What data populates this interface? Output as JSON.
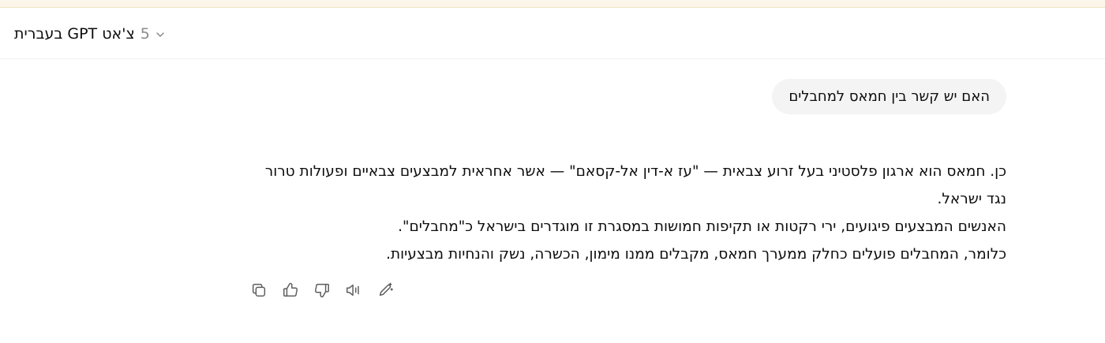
{
  "header": {
    "model_name": "צ'אט GPT בעברית",
    "model_version": "5",
    "chevron_icon": "chevron-down-icon"
  },
  "conversation": {
    "user_message": "האם יש קשר בין חמאס למחבלים",
    "assistant_lines": [
      "כן. חמאס הוא ארגון פלסטיני בעל זרוע צבאית — \"עז א-דין אל-קסאם\" — אשר אחראית למבצעים צבאיים ופעולות טרור נגד ישראל.",
      "האנשים המבצעים פיגועים, ירי רקטות או תקיפות חמושות במסגרת זו מוגדרים בישראל כ\"מחבלים\".",
      "כלומר, המחבלים פועלים כחלק ממערך חמאס, מקבלים ממנו מימון, הכשרה, נשק והנחיות מבצעיות."
    ]
  },
  "actions": {
    "icons": [
      "copy-icon",
      "thumbs-up-icon",
      "thumbs-down-icon",
      "read-aloud-icon",
      "edit-icon"
    ]
  },
  "colors": {
    "top_strip": "#fbf6e9",
    "bubble_bg": "#f4f4f4",
    "text": "#0d0d0d",
    "muted": "#8a8a8a",
    "icon": "#5d5d5d"
  }
}
